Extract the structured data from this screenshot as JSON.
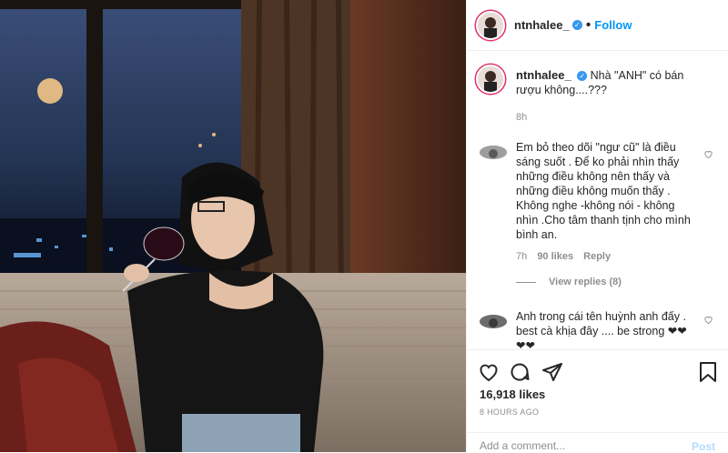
{
  "post": {
    "username": "ntnhalee_",
    "follow_label": "Follow",
    "verified_glyph": "✓",
    "caption_text": "Nhà \"ANH\" có bán rượu không....???",
    "caption_time": "8h",
    "likes": "16,918 likes",
    "time_ago": "8 HOURS AGO"
  },
  "comments": [
    {
      "text": "Em bỏ theo dõi \"ngư cũ\" là điều sáng suốt . Để ko phải nhìn thấy những điều không nên thấy và những điều không muốn thấy . Không nghe -không nói - không nhìn .Cho tâm thanh tịnh cho mình bình an.",
      "time": "7h",
      "likes": "90 likes",
      "reply": "Reply",
      "view_replies": "View replies (8)"
    },
    {
      "text": "Anh trong cái tên huỳnh anh đấy . best cà khịa đây .... be strong ❤❤❤❤"
    }
  ],
  "add_comment": {
    "placeholder": "Add a comment...",
    "post_label": "Post"
  },
  "colors": {
    "accent": "#0095f6",
    "verified": "#3897f0",
    "muted": "#8e8e8e"
  },
  "icons": [
    "heart-icon",
    "comment-icon",
    "share-icon",
    "bookmark-icon",
    "verified-icon"
  ]
}
